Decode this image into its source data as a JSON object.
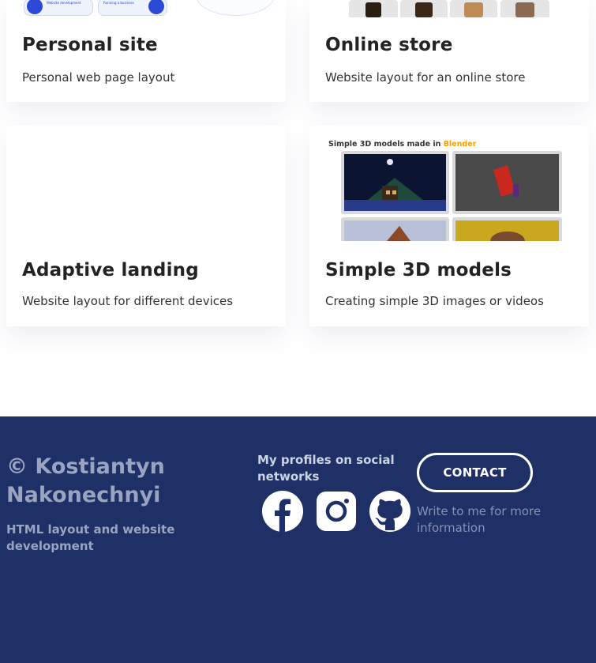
{
  "cards": [
    {
      "title": "Personal site",
      "description": "Personal web page layout"
    },
    {
      "title": "Online store",
      "description": "Website layout for an online store"
    },
    {
      "title": "Adaptive landing",
      "description": "Website layout for different devices"
    },
    {
      "title": "Simple 3D models",
      "description": "Creating simple 3D images or videos"
    }
  ],
  "thumbs": {
    "personal": {
      "pill1": "Website development",
      "pill2": "Running a business"
    },
    "models": {
      "caption_prefix": "Simple 3D models made in",
      "caption_brand": "Blender"
    }
  },
  "footer": {
    "copyright": "© Kostiantyn Nakonechnyi",
    "tagline": "HTML layout and website development",
    "social_title": "My profiles on social networks",
    "social_links": [
      {
        "name": "Facebook",
        "icon": "facebook-icon"
      },
      {
        "name": "Instagram",
        "icon": "instagram-icon"
      },
      {
        "name": "GitHub",
        "icon": "github-icon"
      }
    ],
    "contact_label": "CONTACT",
    "contact_note": "Write to me for more information"
  },
  "colors": {
    "footer_bg": "#1f3067",
    "brand_blue": "#2c48d6",
    "blender_orange": "#f5a300"
  }
}
